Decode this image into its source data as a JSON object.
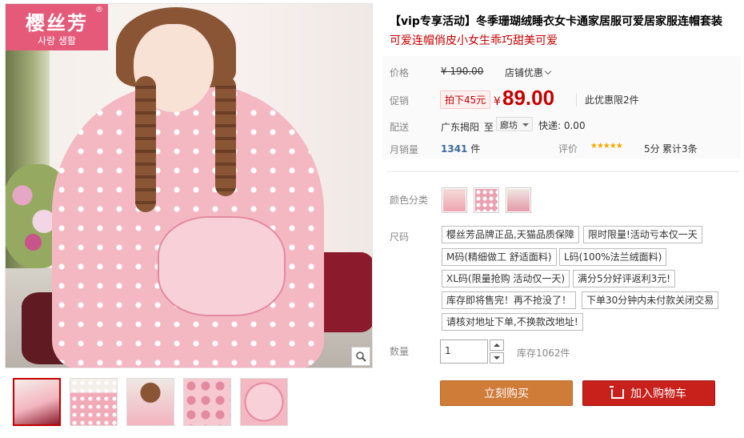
{
  "brand": {
    "name": "樱丝芳",
    "sub": "사랑 생활",
    "reg": "®"
  },
  "product": {
    "title": "【vip专享活动】冬季珊瑚绒睡衣女卡通家居服可爱居家服连帽套装",
    "subtitle": "可爱连帽俏皮小女生乖巧甜美可爱"
  },
  "price": {
    "label": "价格",
    "original": "¥ 190.00",
    "shop_discount": "店铺优惠",
    "promo_label": "促销",
    "discount_tag": "拍下45元",
    "currency": "¥",
    "promo_price": "89.00",
    "limit": "此优惠限2件"
  },
  "shipping": {
    "label": "配送",
    "from": "广东揭阳",
    "to_word": "至",
    "to": "廊坊",
    "express": "快递: 0.00"
  },
  "sales": {
    "label": "月销量",
    "count": "1341",
    "unit": "件"
  },
  "rating": {
    "label": "评价",
    "stars": "★★★★★",
    "score": "5分",
    "total": "累计3条"
  },
  "color": {
    "label": "颜色分类"
  },
  "size": {
    "label": "尺码",
    "options": [
      "樱丝芳品牌正品,天猫品质保障",
      "限时限量!活动亏本仅一天",
      "M码(精细做工 舒适面料)",
      "L码(100%法兰绒面料)",
      "XL码(限量抢购 活动仅一天)",
      "满分5分好评返利3元!",
      "库存即将售完！再不抢没了！",
      "下单30分钟内未付款关闭交易",
      "请核对地址下单,不换款改地址!"
    ]
  },
  "quantity": {
    "label": "数量",
    "value": "1",
    "stock": "库存1062件"
  },
  "actions": {
    "buy": "立刻购买",
    "cart": "加入购物车"
  },
  "colors": {
    "price_red": "#c40000",
    "buy_btn": "#d07c39",
    "cart_btn": "#c8201b",
    "logo_bg": "#e45a78"
  }
}
